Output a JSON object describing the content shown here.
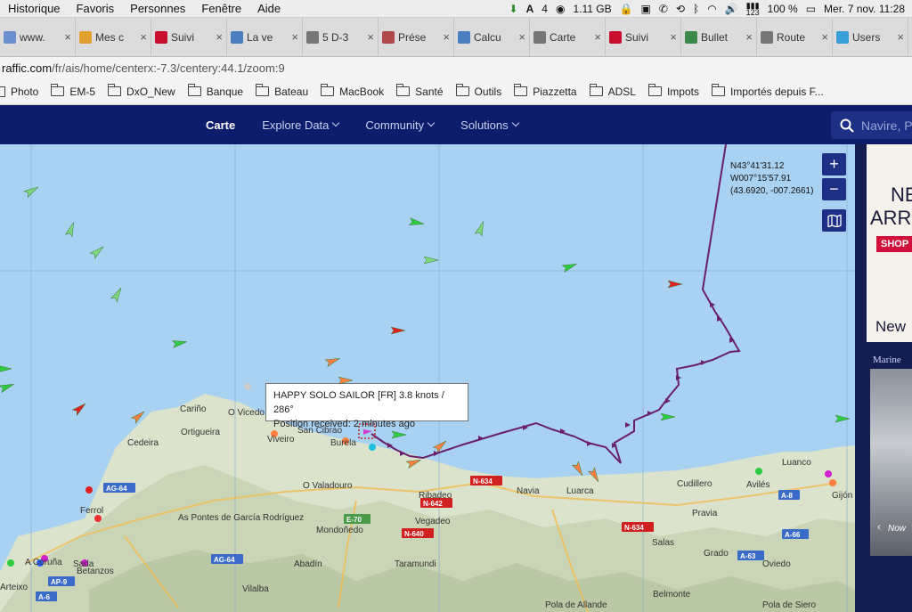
{
  "menubar": {
    "items": [
      "Historique",
      "Favoris",
      "Personnes",
      "Fenêtre",
      "Aide"
    ],
    "status_a": "4",
    "memory": "1.11 GB",
    "keyboard_num": "123",
    "battery": "100 %",
    "clock": "Mer. 7 nov.  11:28"
  },
  "tabs": [
    {
      "label": "www.",
      "icon": "globe-icon",
      "color": "#6c8fd0"
    },
    {
      "label": "Mes c",
      "icon": "gmail-icon",
      "color": "#e0a030"
    },
    {
      "label": "Suivi",
      "icon": "flag-icon",
      "color": "#c8102e"
    },
    {
      "label": "La ve",
      "icon": "puzzle-icon",
      "color": "#4a7fc1"
    },
    {
      "label": "5 D-3",
      "icon": "document-icon",
      "color": "#777777"
    },
    {
      "label": "Prése",
      "icon": "chart-icon",
      "color": "#b04a4a"
    },
    {
      "label": "Calcu",
      "icon": "puzzle-icon",
      "color": "#4a7fc1"
    },
    {
      "label": "Carte",
      "icon": "document-icon",
      "color": "#777777"
    },
    {
      "label": "Suivi",
      "icon": "flag-icon",
      "color": "#c8102e"
    },
    {
      "label": "Bullet",
      "icon": "map-icon",
      "color": "#3a8a4a"
    },
    {
      "label": "Route",
      "icon": "document-icon",
      "color": "#777777"
    },
    {
      "label": "Users",
      "icon": "gift-icon",
      "color": "#3aa0d8"
    }
  ],
  "url": {
    "host": "raffic.com",
    "path": "/fr/ais/home/centerx:-7.3/centery:44.1/zoom:9"
  },
  "bookmarks": {
    "first": "Photo",
    "folders": [
      "EM-5",
      "DxO_New",
      "Banque",
      "Bateau",
      "MacBook",
      "Santé",
      "Outils",
      "Piazzetta",
      "ADSL",
      "Impots",
      "Importés depuis F..."
    ]
  },
  "nav": {
    "items": [
      {
        "label": "Carte",
        "active": true,
        "dropdown": false
      },
      {
        "label": "Explore Data",
        "active": false,
        "dropdown": true
      },
      {
        "label": "Community",
        "active": false,
        "dropdown": true
      },
      {
        "label": "Solutions",
        "active": false,
        "dropdown": true
      }
    ],
    "search_placeholder": "Navire, P"
  },
  "map": {
    "zoom_in": "+",
    "zoom_out": "−",
    "coords": {
      "lat": "N43°41'31.12",
      "lon": "W007°15'57.91",
      "decimal": "(43.6920, -007.2661)"
    },
    "tooltip": {
      "line1": "HAPPY SOLO SAILOR [FR] 3.8 knots / 286°",
      "line2": "Position received: 2 minutes ago"
    },
    "places": [
      "Cariño",
      "O Vicedo",
      "Ortigueira",
      "Viveiro",
      "San Cibrao",
      "Burela",
      "Cedeira",
      "O Valadouro",
      "Ferrol",
      "As Pontes de García Rodríguez",
      "Mondoñedo",
      "A Coruña",
      "Sada",
      "Arteixo",
      "Betanzos",
      "Abadín",
      "Vilalba",
      "Ribadeo",
      "Vegadeo",
      "Taramundi",
      "Navia",
      "Luarca",
      "Cudillero",
      "Avilés",
      "Luanco",
      "Gijón",
      "Pravia",
      "Salas",
      "Grado",
      "Oviedo",
      "Belmonte",
      "Pola de Allande",
      "Pola de Siero"
    ],
    "roads": [
      "AG-64",
      "AG-64",
      "AP-9",
      "A-6",
      "E-70",
      "N-642",
      "N-640",
      "N-634",
      "N-634",
      "A-8",
      "A-66",
      "A-63"
    ],
    "colors": {
      "sea": "#a9d2f2",
      "land": "#dde5cf",
      "track": "#6b1f6b"
    }
  },
  "ad": {
    "headline1": "NE",
    "headline2": "ARRI",
    "cta": "SHOP",
    "footer": "New",
    "label": "Marine",
    "nav": "Now"
  }
}
